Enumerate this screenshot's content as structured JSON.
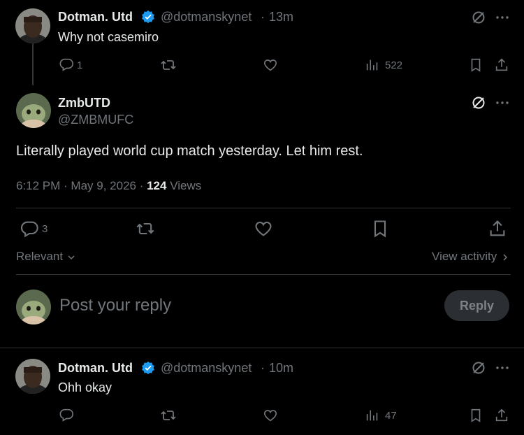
{
  "reply1": {
    "name": "Dotman. Utd",
    "handle": "@dotmanskynet",
    "sep": "·",
    "time": "13m",
    "text": "Why not casemiro",
    "replies": "1",
    "views": "522"
  },
  "main": {
    "name": "ZmbUTD",
    "handle": "@ZMBMUFC",
    "text": "Literally played world cup match yesterday. Let him rest.",
    "timestamp": "6:12 PM · May 9, 2026 · ",
    "views_count": "124",
    "views_label": " Views",
    "replies": "3"
  },
  "sort": {
    "label": "Relevant",
    "view_activity": "View activity"
  },
  "composer": {
    "placeholder": "Post your reply",
    "reply_button": "Reply"
  },
  "reply2": {
    "name": "Dotman. Utd",
    "handle": "@dotmanskynet",
    "sep": "·",
    "time": "10m",
    "text": "Ohh okay",
    "views": "47"
  },
  "colors": {
    "background": "#000000",
    "text": "#e7e9ea",
    "muted": "#71767b",
    "verified": "#1d9bf0",
    "divider": "#2f3336",
    "reply_button_bg": "#2b2f33",
    "reply_button_text": "#7d8287"
  },
  "icons": [
    "grok-icon",
    "more-icon",
    "reply-icon",
    "retweet-icon",
    "like-icon",
    "views-icon",
    "bookmark-icon",
    "share-icon",
    "chevron-down-icon",
    "chevron-right-icon",
    "verified-badge-icon"
  ]
}
